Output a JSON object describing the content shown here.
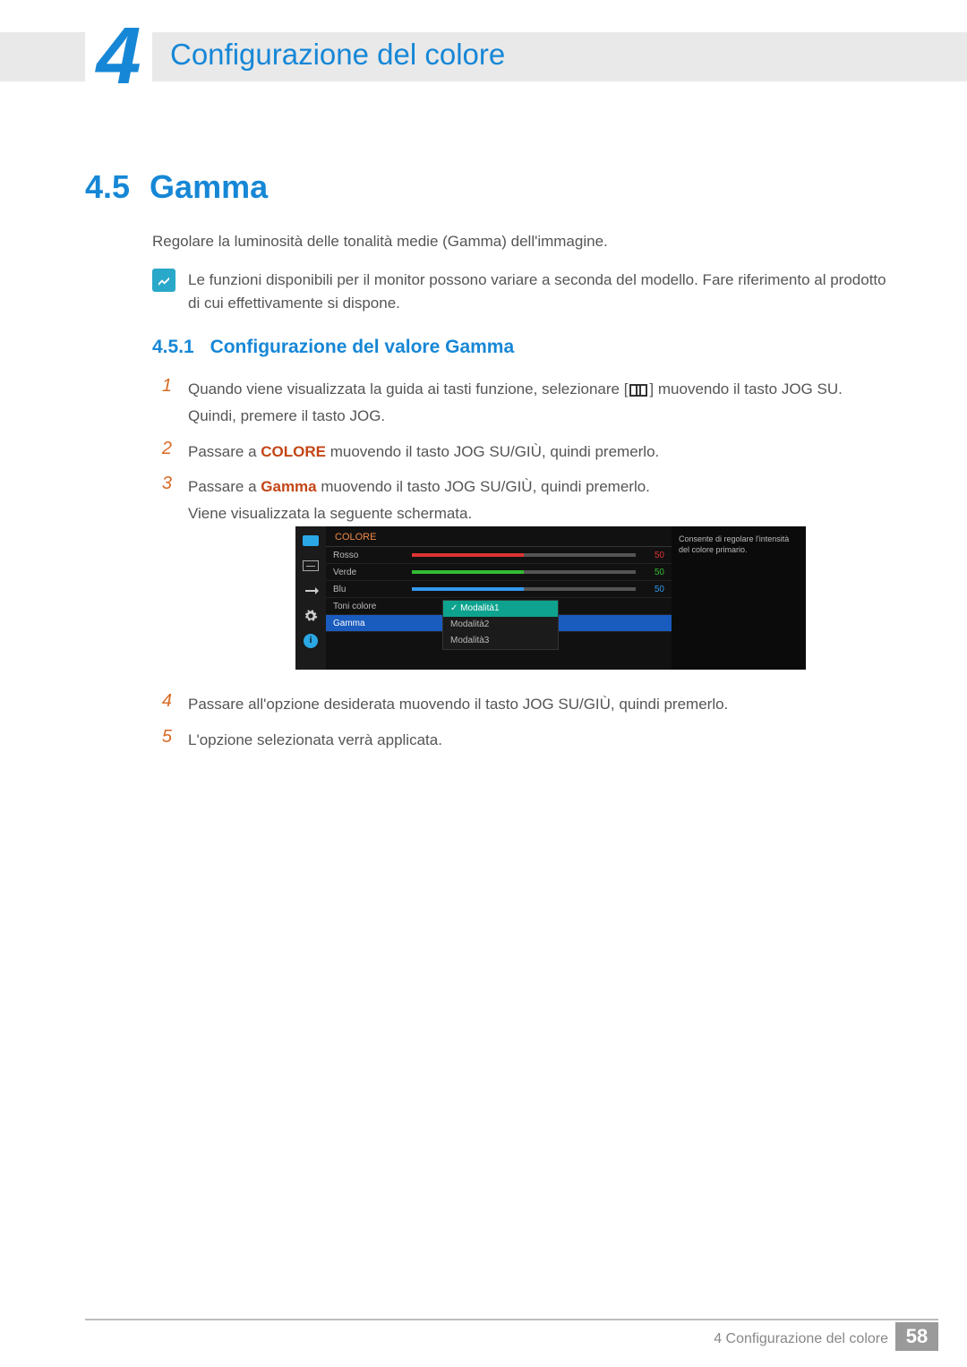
{
  "chapter": {
    "number": "4",
    "title": "Configurazione del colore"
  },
  "section": {
    "number": "4.5",
    "title": "Gamma"
  },
  "intro": "Regolare la luminosità delle tonalità medie (Gamma) dell'immagine.",
  "note": "Le funzioni disponibili per il monitor possono variare a seconda del modello. Fare riferimento al prodotto di cui effettivamente si dispone.",
  "subsection": {
    "number": "4.5.1",
    "title": "Configurazione del valore Gamma"
  },
  "steps": {
    "s1": {
      "n": "1",
      "pre": "Quando viene visualizzata la guida ai tasti funzione, selezionare [",
      "post": "] muovendo il tasto JOG SU. Quindi, premere il tasto JOG."
    },
    "s2": {
      "n": "2",
      "pre": "Passare a ",
      "em": "COLORE",
      "post": " muovendo il tasto JOG SU/GIÙ, quindi premerlo."
    },
    "s3": {
      "n": "3",
      "pre": "Passare a ",
      "em": "Gamma",
      "post": " muovendo il tasto JOG SU/GIÙ, quindi premerlo.",
      "line2": "Viene visualizzata la seguente schermata."
    },
    "s4": {
      "n": "4",
      "text": "Passare all'opzione desiderata muovendo il tasto JOG SU/GIÙ, quindi premerlo."
    },
    "s5": {
      "n": "5",
      "text": "L'opzione selezionata verrà applicata."
    }
  },
  "osd": {
    "title": "COLORE",
    "rows": {
      "r": {
        "label": "Rosso",
        "value": "50",
        "color": "#d33",
        "valcolor": "#d33"
      },
      "g": {
        "label": "Verde",
        "value": "50",
        "color": "#3b3",
        "valcolor": "#3b3"
      },
      "b": {
        "label": "Blu",
        "value": "50",
        "color": "#39e",
        "valcolor": "#39e"
      },
      "tone": {
        "label": "Toni colore"
      },
      "gamma": {
        "label": "Gamma"
      }
    },
    "popup": {
      "m1": "Modalità1",
      "m2": "Modalità2",
      "m3": "Modalità3"
    },
    "help": "Consente di regolare l'intensità del colore primario.",
    "info_glyph": "i"
  },
  "footer": {
    "text": "4 Configurazione del colore",
    "page": "58"
  }
}
